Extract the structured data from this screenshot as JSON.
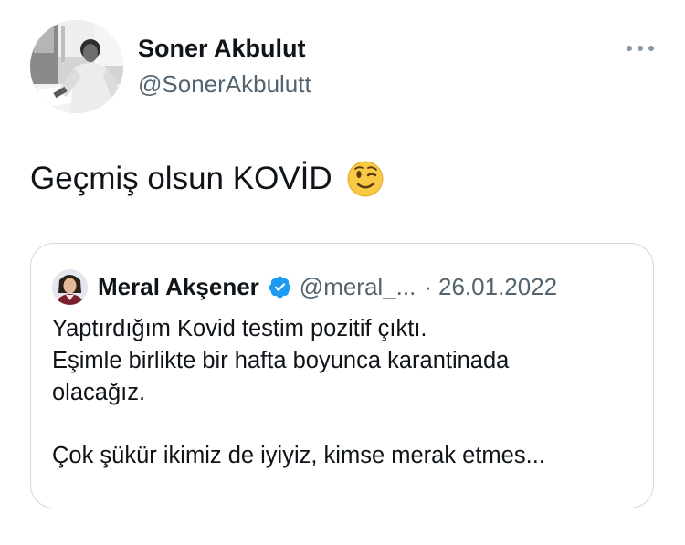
{
  "tweet": {
    "author": {
      "name": "Soner Akbulut",
      "handle": "@SonerAkbulutt",
      "avatar_icon": "profile-photo"
    },
    "more_icon": "more-horizontal-icon",
    "text": "Geçmiş olsun KOVİD",
    "emoji": "winking-face-emoji",
    "quoted": {
      "author": {
        "name": "Meral Akşener",
        "handle": "@meral_...",
        "verified_icon": "verified-badge-icon",
        "avatar_icon": "profile-photo"
      },
      "separator": "·",
      "date": "26.01.2022",
      "lines": [
        "Yaptırdığım Kovid testim pozitif çıktı.",
        "Eşimle birlikte bir hafta boyunca karantinada",
        "olacağız.",
        "",
        "Çok şükür ikimiz de iyiyiz, kimse merak etmes..."
      ]
    }
  },
  "colors": {
    "text_primary": "#0f1419",
    "text_secondary": "#536471",
    "border": "#cfd9de",
    "verified_blue": "#1d9bf0",
    "emoji_yellow": "#f7c945"
  }
}
